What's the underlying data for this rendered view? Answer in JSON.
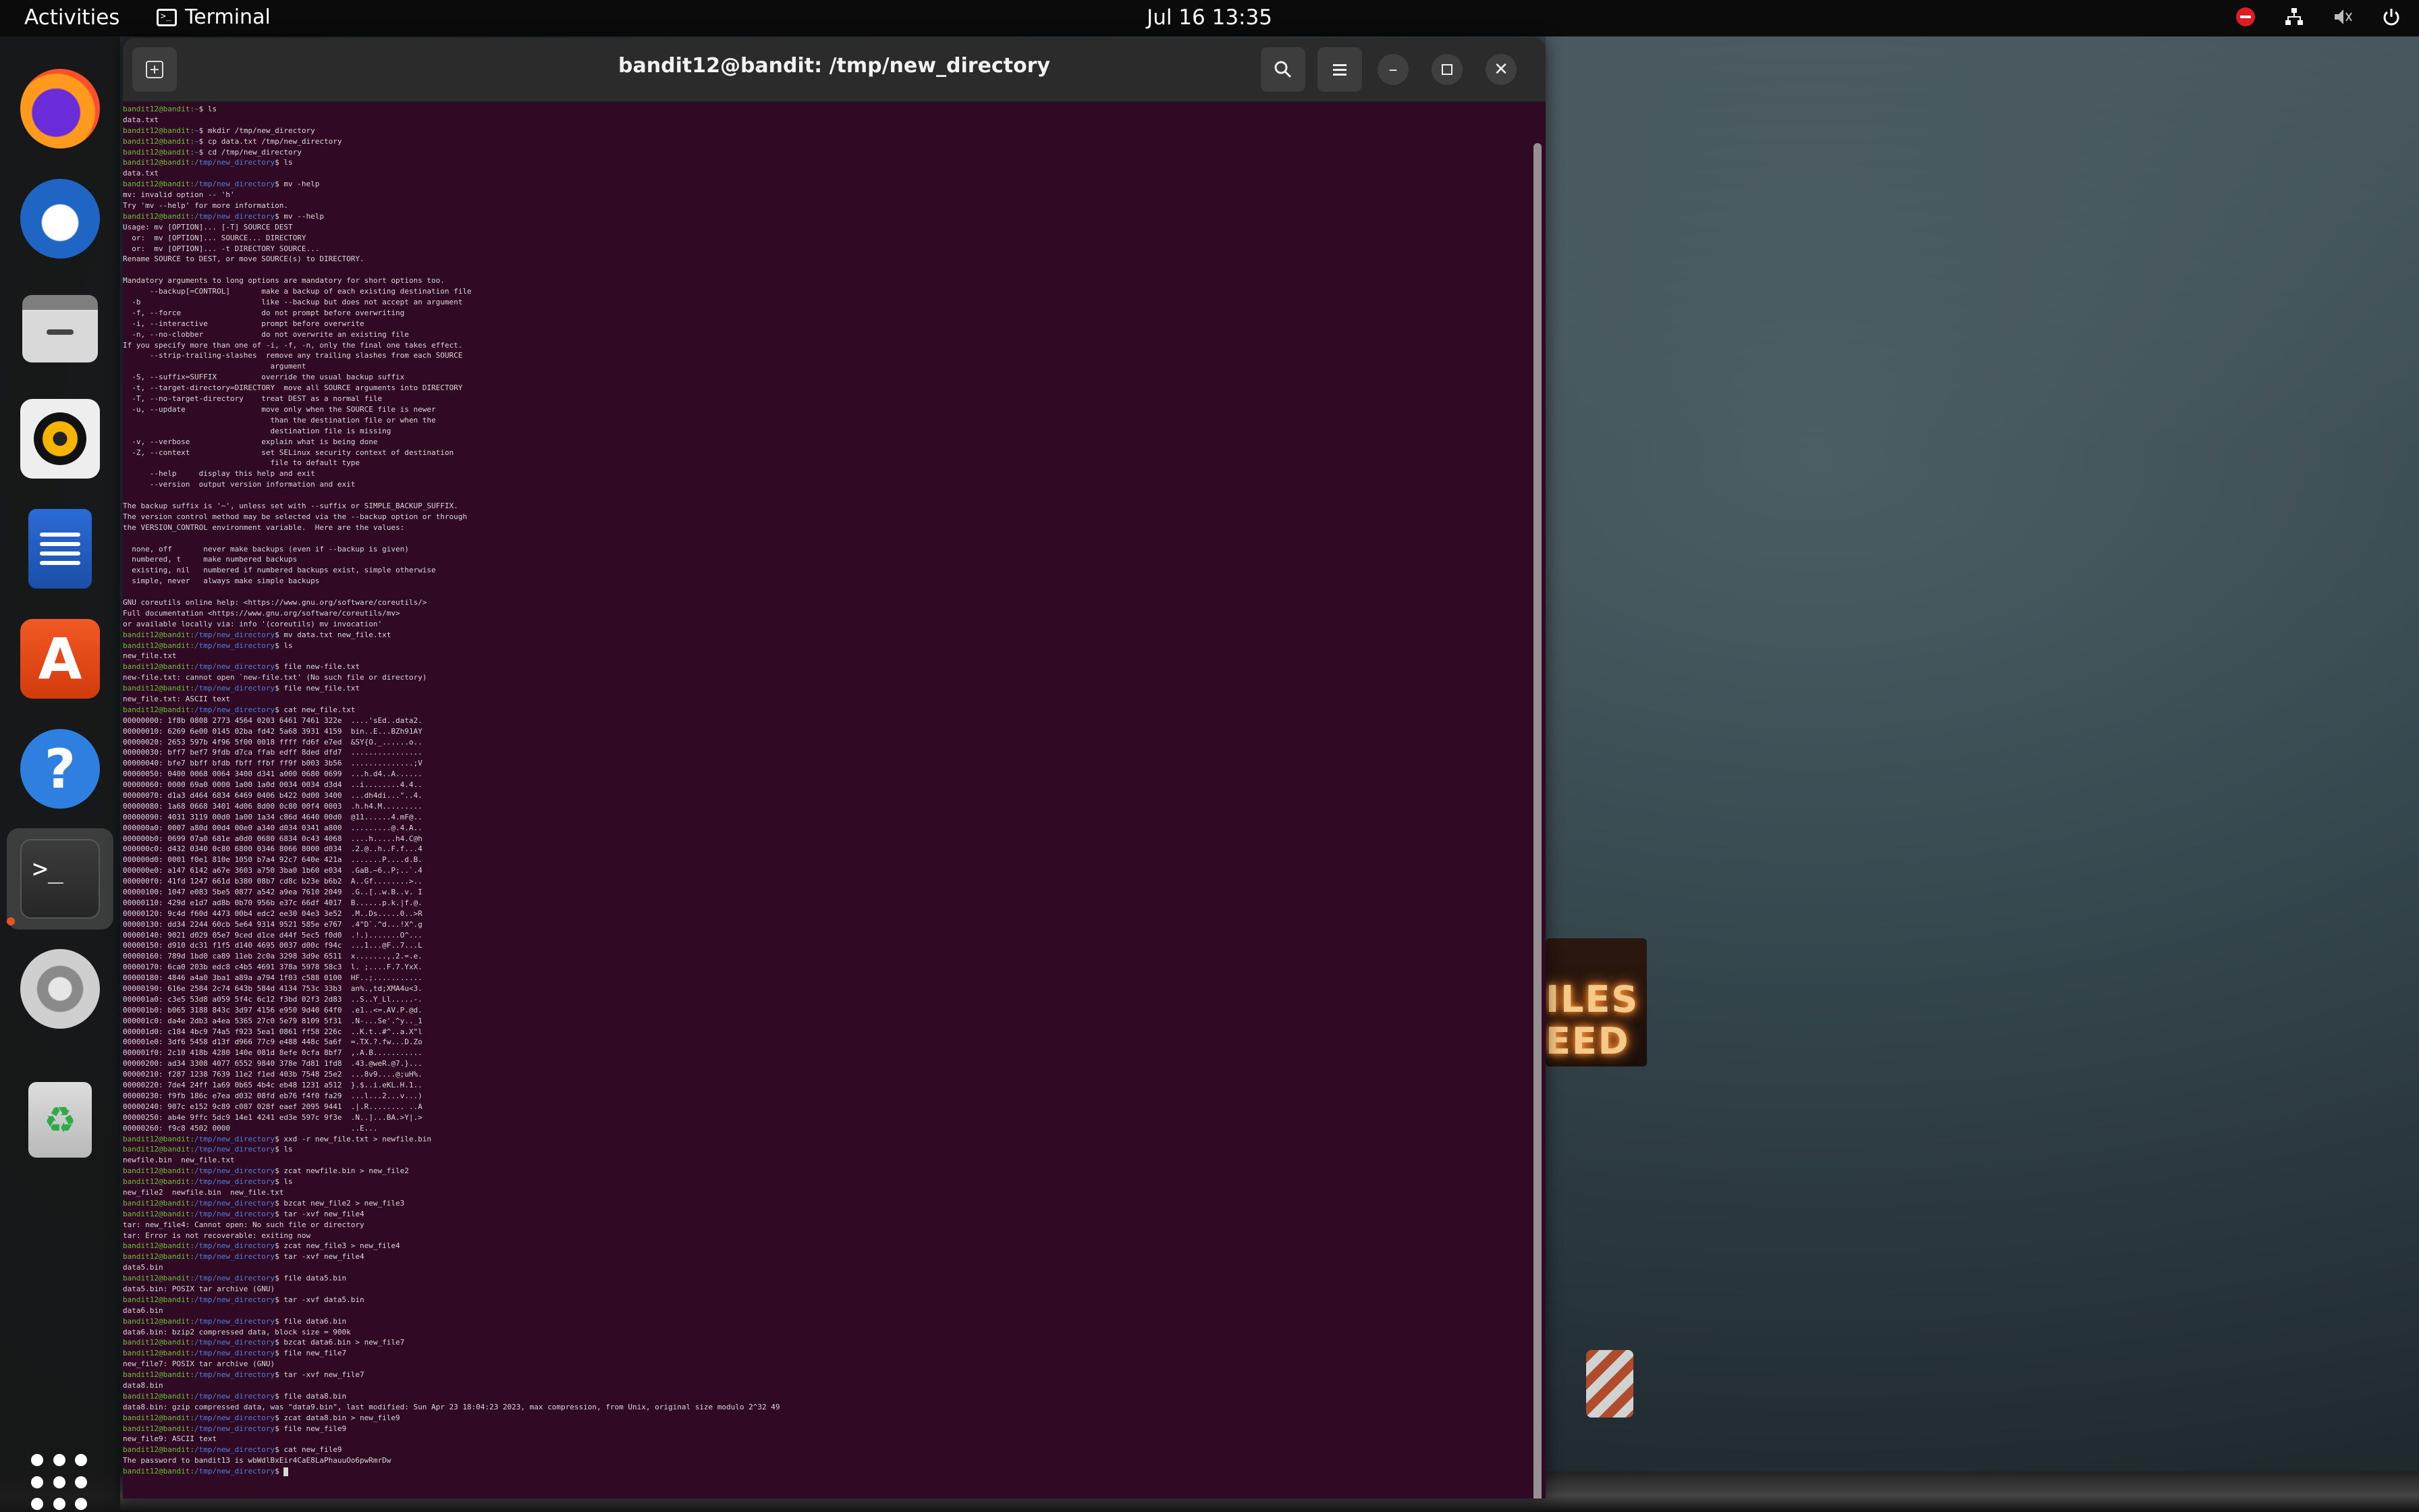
{
  "topbar": {
    "activities": "Activities",
    "app_name": "Terminal",
    "clock": "Jul 16  13:35"
  },
  "dock": {
    "items": [
      "firefox",
      "thunderbird",
      "files",
      "rhythmbox",
      "libreoffice-writer",
      "app-center",
      "help",
      "terminal",
      "settings",
      "trash"
    ]
  },
  "window": {
    "title": "bandit12@bandit: /tmp/new_directory"
  },
  "terminal": {
    "prompt_user_home": "bandit12@bandit:",
    "prompt_home_path": "~",
    "prompt_user": "bandit12@bandit:",
    "prompt_path": "/tmp/new_directory",
    "lines": [
      {
        "p": "h",
        "c": "$ ls"
      },
      {
        "t": "data.txt"
      },
      {
        "p": "h",
        "c": "$ mkdir /tmp/new_directory"
      },
      {
        "p": "h",
        "c": "$ cp data.txt /tmp/new_directory"
      },
      {
        "p": "h",
        "c": "$ cd /tmp/new_directory"
      },
      {
        "p": "d",
        "c": "$ ls"
      },
      {
        "t": "data.txt"
      },
      {
        "p": "d",
        "c": "$ mv -help"
      },
      {
        "t": "mv: invalid option -- 'h'"
      },
      {
        "t": "Try 'mv --help' for more information."
      },
      {
        "p": "d",
        "c": "$ mv --help"
      },
      {
        "t": "Usage: mv [OPTION]... [-T] SOURCE DEST"
      },
      {
        "t": "  or:  mv [OPTION]... SOURCE... DIRECTORY"
      },
      {
        "t": "  or:  mv [OPTION]... -t DIRECTORY SOURCE..."
      },
      {
        "t": "Rename SOURCE to DEST, or move SOURCE(s) to DIRECTORY."
      },
      {
        "t": ""
      },
      {
        "t": "Mandatory arguments to long options are mandatory for short options too."
      },
      {
        "t": "      --backup[=CONTROL]       make a backup of each existing destination file"
      },
      {
        "t": "  -b                           like --backup but does not accept an argument"
      },
      {
        "t": "  -f, --force                  do not prompt before overwriting"
      },
      {
        "t": "  -i, --interactive            prompt before overwrite"
      },
      {
        "t": "  -n, --no-clobber             do not overwrite an existing file"
      },
      {
        "t": "If you specify more than one of -i, -f, -n, only the final one takes effect."
      },
      {
        "t": "      --strip-trailing-slashes  remove any trailing slashes from each SOURCE"
      },
      {
        "t": "                                 argument"
      },
      {
        "t": "  -S, --suffix=SUFFIX          override the usual backup suffix"
      },
      {
        "t": "  -t, --target-directory=DIRECTORY  move all SOURCE arguments into DIRECTORY"
      },
      {
        "t": "  -T, --no-target-directory    treat DEST as a normal file"
      },
      {
        "t": "  -u, --update                 move only when the SOURCE file is newer"
      },
      {
        "t": "                                 than the destination file or when the"
      },
      {
        "t": "                                 destination file is missing"
      },
      {
        "t": "  -v, --verbose                explain what is being done"
      },
      {
        "t": "  -Z, --context                set SELinux security context of destination"
      },
      {
        "t": "                                 file to default type"
      },
      {
        "t": "      --help     display this help and exit"
      },
      {
        "t": "      --version  output version information and exit"
      },
      {
        "t": ""
      },
      {
        "t": "The backup suffix is '~', unless set with --suffix or SIMPLE_BACKUP_SUFFIX."
      },
      {
        "t": "The version control method may be selected via the --backup option or through"
      },
      {
        "t": "the VERSION_CONTROL environment variable.  Here are the values:"
      },
      {
        "t": ""
      },
      {
        "t": "  none, off       never make backups (even if --backup is given)"
      },
      {
        "t": "  numbered, t     make numbered backups"
      },
      {
        "t": "  existing, nil   numbered if numbered backups exist, simple otherwise"
      },
      {
        "t": "  simple, never   always make simple backups"
      },
      {
        "t": ""
      },
      {
        "t": "GNU coreutils online help: <https://www.gnu.org/software/coreutils/>"
      },
      {
        "t": "Full documentation <https://www.gnu.org/software/coreutils/mv>"
      },
      {
        "t": "or available locally via: info '(coreutils) mv invocation'"
      },
      {
        "p": "d",
        "c": "$ mv data.txt new_file.txt"
      },
      {
        "p": "d",
        "c": "$ ls"
      },
      {
        "t": "new_file.txt"
      },
      {
        "p": "d",
        "c": "$ file new-file.txt"
      },
      {
        "t": "new-file.txt: cannot open `new-file.txt' (No such file or directory)"
      },
      {
        "p": "d",
        "c": "$ file new_file.txt"
      },
      {
        "t": "new_file.txt: ASCII text"
      },
      {
        "p": "d",
        "c": "$ cat new_file.txt"
      },
      {
        "t": "00000000: 1f8b 0808 2773 4564 0203 6461 7461 322e  ....'sEd..data2."
      },
      {
        "t": "00000010: 6269 6e00 0145 02ba fd42 5a68 3931 4159  bin..E...BZh91AY"
      },
      {
        "t": "00000020: 2653 597b 4f96 5f00 0018 ffff fd6f e7ed  &SY{O._......o.."
      },
      {
        "t": "00000030: bff7 bef7 9fdb d7ca ffab edff 8ded dfd7  ................"
      },
      {
        "t": "00000040: bfe7 bbff bfdb fbff ffbf ff9f b003 3b56  ..............;V"
      },
      {
        "t": "00000050: 0400 0068 0064 3400 d341 a000 0680 0699  ...h.d4..A......"
      },
      {
        "t": "00000060: 0000 69a0 0000 1a00 1a0d 0034 0034 d3d4  ..i........4.4.."
      },
      {
        "t": "00000070: d1a3 d464 6834 6469 0406 b422 0d00 3400  ...dh4di...\"..4."
      },
      {
        "t": "00000080: 1a68 0668 3401 4d06 8d00 0c80 00f4 0003  .h.h4.M........."
      },
      {
        "t": "00000090: 4031 3119 00d0 1a00 1a34 c86d 4640 00d0  @11......4.mF@.."
      },
      {
        "t": "000000a0: 0007 a80d 00d4 00e0 a340 d034 0341 a800  .........@.4.A.."
      },
      {
        "t": "000000b0: 0699 07a0 681e a0d0 0680 6834 0c43 4068  ....h.....h4.C@h"
      },
      {
        "t": "000000c0: d432 0340 0c80 6800 0346 8066 8000 d034  .2.@..h..F.f...4"
      },
      {
        "t": "000000d0: 0001 f0e1 810e 1050 b7a4 92c7 640e 421a  .......P....d.B."
      },
      {
        "t": "000000e0: a147 6142 a67e 3603 a750 3ba0 1b60 e034  .GaB.~6..P;..`.4"
      },
      {
        "t": "000000f0: 41fd 1247 661d b380 08b7 cd8c b23e b6b2  A..Gf........>.."
      },
      {
        "t": "00000100: 1047 e083 5be5 0877 a542 a9ea 7610 2049  .G..[..w.B..v. I"
      },
      {
        "t": "00000110: 429d e1d7 ad8b 0b70 956b e37c 66df 4017  B......p.k.|f.@."
      },
      {
        "t": "00000120: 9c4d f60d 4473 00b4 edc2 ee30 04e3 3e52  .M..Ds.....0..>R"
      },
      {
        "t": "00000130: dd34 2244 60cb 5e64 9314 9521 585e e767  .4\"D`.^d...!X^.g"
      },
      {
        "t": "00000140: 9021 d029 05e7 9ced d1ce d44f 5ec5 f0d0  .!.).......O^..."
      },
      {
        "t": "00000150: d910 dc31 f1f5 d140 4695 0037 d00c f94c  ...1...@F..7...L"
      },
      {
        "t": "00000160: 789d 1bd0 ca89 11eb 2c0a 3298 3d9e 6511  x.......,.2.=.e."
      },
      {
        "t": "00000170: 6ca0 203b edc8 c4b5 4691 378a 5978 58c3  l. ;....F.7.YxX."
      },
      {
        "t": "00000180: 4846 a4a0 3ba1 a89a a794 1f03 c588 0100  HF..;..........."
      },
      {
        "t": "00000190: 616e 2584 2c74 643b 584d 4134 753c 33b3  an%.,td;XMA4u<3."
      },
      {
        "t": "000001a0: c3e5 53d8 a059 5f4c 6c12 f3bd 02f3 2d83  ..S..Y_Ll.....-."
      },
      {
        "t": "000001b0: b065 3188 843c 3d97 4156 e950 9d40 64f0  .e1..<=.AV.P.@d."
      },
      {
        "t": "000001c0: da4e 2db3 a4ea 5365 27c0 5e79 8109 5f31  .N-...Se'.^y.._1"
      },
      {
        "t": "000001d0: c184 4bc9 74a5 f923 5ea1 0861 ff58 226c  ..K.t..#^..a.X\"l"
      },
      {
        "t": "000001e0: 3df6 5458 d13f d966 77c9 e488 448c 5a6f  =.TX.?.fw...D.Zo"
      },
      {
        "t": "000001f0: 2c10 418b 4280 140e 081d 8efe 0cfa 8bf7  ,.A.B..........."
      },
      {
        "t": "00000200: ad34 3308 4077 6552 9840 378e 7d81 1fd8  .43.@weR.@7.}..."
      },
      {
        "t": "00000210: f287 1238 7639 11e2 f1ed 403b 7548 25e2  ...8v9....@;uH%."
      },
      {
        "t": "00000220: 7de4 24ff 1a69 0b65 4b4c eb48 1231 a512  }.$..i.eKL.H.1.."
      },
      {
        "t": "00000230: f9fb 186c e7ea d032 08fd eb76 f4f0 fa29  ...l...2...v...)"
      },
      {
        "t": "00000240: 907c e152 9c89 c087 028f eaef 2095 9441  .|.R........ ..A"
      },
      {
        "t": "00000250: ab4e 9ffc 5dc9 14e1 4241 ed3e 597c 9f3e  .N..]...BA.>Y|.>"
      },
      {
        "t": "00000260: f9c8 4502 0000                           ..E..."
      },
      {
        "p": "d",
        "c": "$ xxd -r new_file.txt > newfile.bin"
      },
      {
        "p": "d",
        "c": "$ ls"
      },
      {
        "t": "newfile.bin  new_file.txt"
      },
      {
        "p": "d",
        "c": "$ zcat newfile.bin > new_file2"
      },
      {
        "p": "d",
        "c": "$ ls"
      },
      {
        "t": "new_file2  newfile.bin  new_file.txt"
      },
      {
        "p": "d",
        "c": "$ bzcat new_file2 > new_file3"
      },
      {
        "p": "d",
        "c": "$ tar -xvf new_file4"
      },
      {
        "t": "tar: new_file4: Cannot open: No such file or directory"
      },
      {
        "t": "tar: Error is not recoverable: exiting now"
      },
      {
        "p": "d",
        "c": "$ zcat new_file3 > new_file4"
      },
      {
        "p": "d",
        "c": "$ tar -xvf new_file4"
      },
      {
        "t": "data5.bin"
      },
      {
        "p": "d",
        "c": "$ file data5.bin"
      },
      {
        "t": "data5.bin: POSIX tar archive (GNU)"
      },
      {
        "p": "d",
        "c": "$ tar -xvf data5.bin"
      },
      {
        "t": "data6.bin"
      },
      {
        "p": "d",
        "c": "$ file data6.bin"
      },
      {
        "t": "data6.bin: bzip2 compressed data, block size = 900k"
      },
      {
        "p": "d",
        "c": "$ bzcat data6.bin > new_file7"
      },
      {
        "p": "d",
        "c": "$ file new_file7"
      },
      {
        "t": "new_file7: POSIX tar archive (GNU)"
      },
      {
        "p": "d",
        "c": "$ tar -xvf new_file7"
      },
      {
        "t": "data8.bin"
      },
      {
        "p": "d",
        "c": "$ file data8.bin"
      },
      {
        "t": "data8.bin: gzip compressed data, was \"data9.bin\", last modified: Sun Apr 23 18:04:23 2023, max compression, from Unix, original size modulo 2^32 49"
      },
      {
        "p": "d",
        "c": "$ zcat data8.bin > new_file9"
      },
      {
        "p": "d",
        "c": "$ file new_file9"
      },
      {
        "t": "new_file9: ASCII text"
      },
      {
        "p": "d",
        "c": "$ cat new_file9"
      },
      {
        "t": "The password to bandit13 is wbWdlBxEir4CaE8LaPhauuOo6pwRmrDw"
      },
      {
        "p": "d",
        "c": "$ ",
        "cursor": true
      }
    ]
  },
  "wallpaper": {
    "sign_text_line1": "ILES",
    "sign_text_line2": "EED"
  },
  "colors": {
    "terminal_bg": "#300a24",
    "prompt_user": "#6ac12f",
    "prompt_path": "#4e80d8",
    "header_bg": "#2b2b2b"
  }
}
